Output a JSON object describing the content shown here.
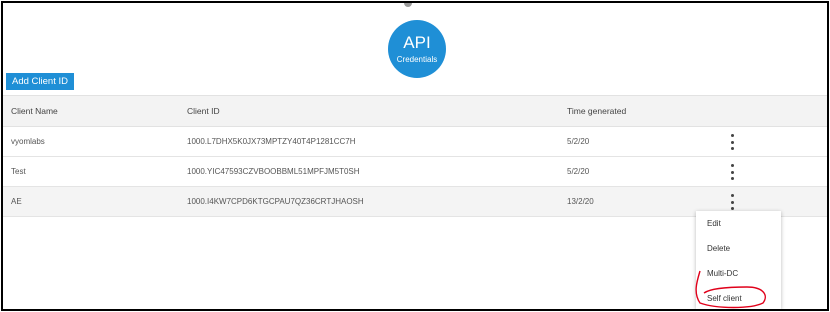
{
  "badge": {
    "title": "API",
    "subtitle": "Credentials"
  },
  "toolbar": {
    "add_label": "Add Client ID"
  },
  "table": {
    "headers": [
      "Client Name",
      "Client ID",
      "Time generated"
    ],
    "rows": [
      {
        "name": "vyomlabs",
        "client_id": "1000.L7DHX5K0JX73MPTZY40T4P1281CC7H",
        "time": "5/2/20"
      },
      {
        "name": "Test",
        "client_id": "1000.YIC47593CZVBOOBBML51MPFJM5T0SH",
        "time": "5/2/20"
      },
      {
        "name": "AE",
        "client_id": "1000.I4KW7CPD6KTGCPAU7QZ36CRTJHAOSH",
        "time": "13/2/20"
      }
    ]
  },
  "menu": {
    "items": [
      "Edit",
      "Delete",
      "Multi-DC",
      "Self client"
    ]
  },
  "colors": {
    "accent": "#1f8fd6",
    "annotation": "#e0001a"
  }
}
